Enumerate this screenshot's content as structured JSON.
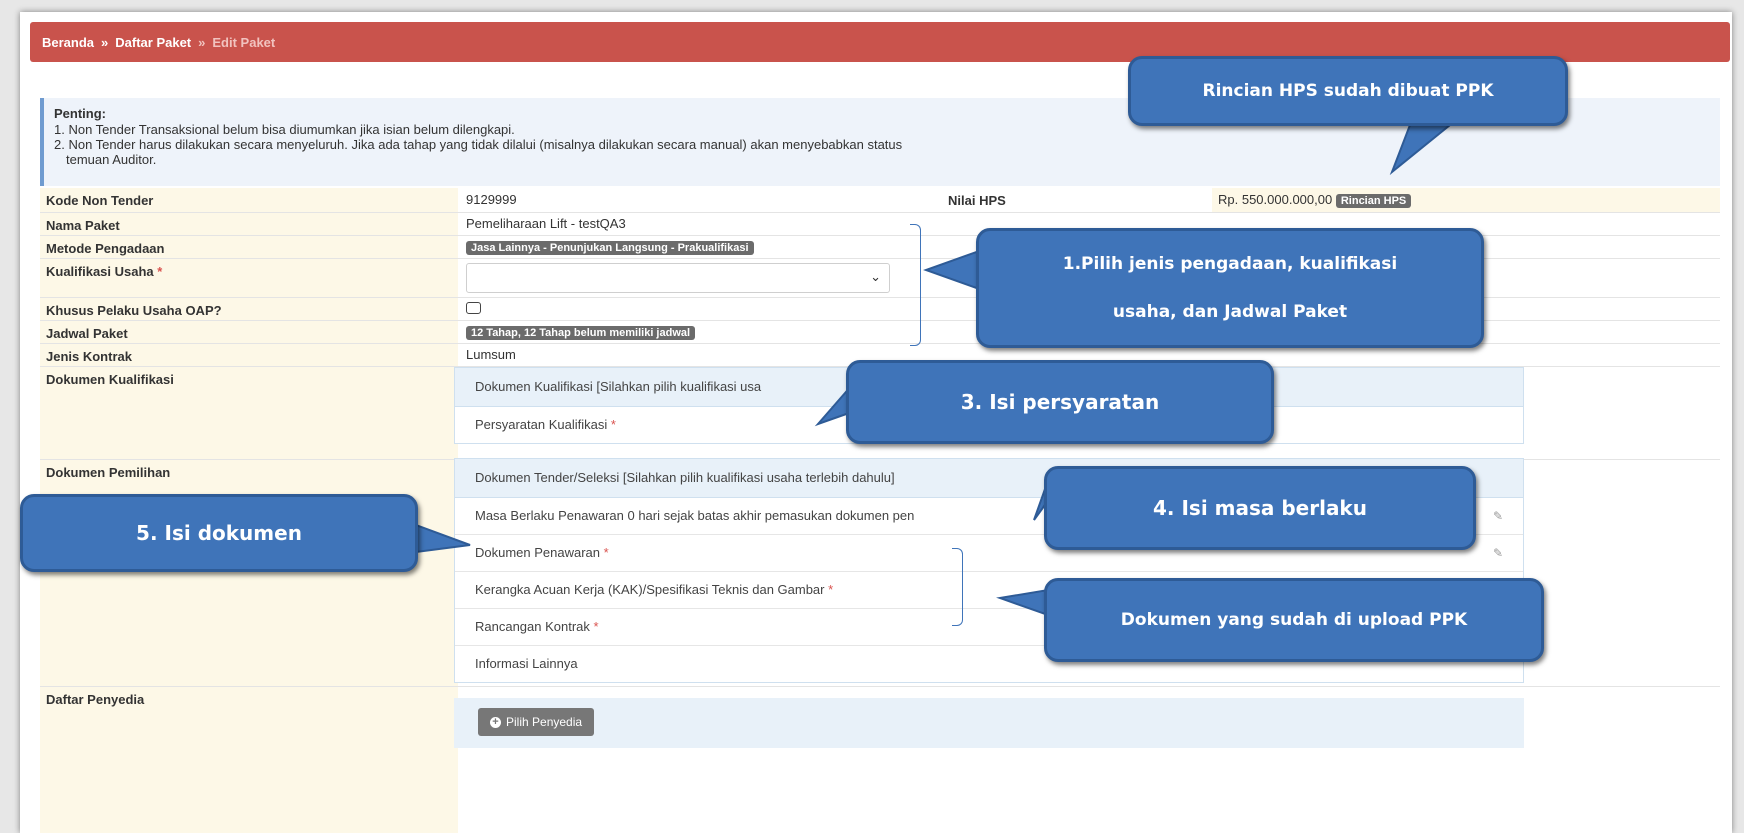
{
  "breadcrumb": {
    "home": "Beranda",
    "sep": "»",
    "list": "Daftar Paket",
    "current": "Edit Paket"
  },
  "alert": {
    "title": "Penting:",
    "line1": "1. Non Tender Transaksional belum bisa diumumkan jika isian belum dilengkapi.",
    "line2": "2. Non Tender harus dilakukan secara menyeluruh. Jika ada tahap yang tidak dilalui (misalnya dilakukan secara manual) akan menyebabkan status",
    "line3": "temuan Auditor."
  },
  "form": {
    "kode_label": "Kode Non Tender",
    "kode_value": "9129999",
    "hps_label": "Nilai HPS",
    "hps_value": "Rp. 550.000.000,00",
    "hps_button": "Rincian HPS",
    "nama_label": "Nama Paket",
    "nama_value": "Pemeliharaan Lift - testQA3",
    "metode_label": "Metode Pengadaan",
    "metode_value": "Jasa Lainnya - Penunjukan Langsung - Prakualifikasi",
    "kualifikasi_label": "Kualifikasi Usaha",
    "kualifikasi_value": "",
    "oap_label": "Khusus Pelaku Usaha OAP?",
    "jadwal_label": "Jadwal Paket",
    "jadwal_value": "12 Tahap, 12 Tahap belum memiliki jadwal",
    "kontrak_label": "Jenis Kontrak",
    "kontrak_value": "Lumsum",
    "dok_kualifikasi_label": "Dokumen Kualifikasi",
    "dok_kualifikasi_head": "Dokumen Kualifikasi [Silahkan pilih kualifikasi usa",
    "persyaratan": "Persyaratan Kualifikasi",
    "dok_pemilihan_label": "Dokumen Pemilihan",
    "dok_pemilihan_head": "Dokumen Tender/Seleksi [Silahkan pilih kualifikasi usaha terlebih dahulu]",
    "masa_berlaku": "Masa Berlaku Penawaran 0 hari sejak batas akhir pemasukan dokumen pen",
    "dok_penawaran": "Dokumen Penawaran",
    "kak": "Kerangka Acuan Kerja (KAK)/Spesifikasi Teknis dan Gambar",
    "rancangan": "Rancangan Kontrak",
    "informasi": "Informasi Lainnya",
    "penyedia_label": "Daftar Penyedia",
    "penyedia_button": "Pilih Penyedia",
    "required": "*"
  },
  "callouts": {
    "hps": "Rincian HPS sudah dibuat PPK",
    "pilih_line1": "1.Pilih jenis pengadaan, kualifikasi",
    "pilih_line2": "usaha, dan Jadwal Paket",
    "persyaratan": "3.  Isi  persyaratan",
    "masa": "4.  Isi  masa berlaku",
    "dokumen": "5.  Isi  dokumen",
    "upload": "Dokumen yang sudah di upload PPK"
  },
  "colors": {
    "breadcrumb_bg": "#c9534c",
    "callout_bg": "#3f74b9",
    "label_bg": "#fdf8e7",
    "panel_head_bg": "#e8f1f9"
  }
}
